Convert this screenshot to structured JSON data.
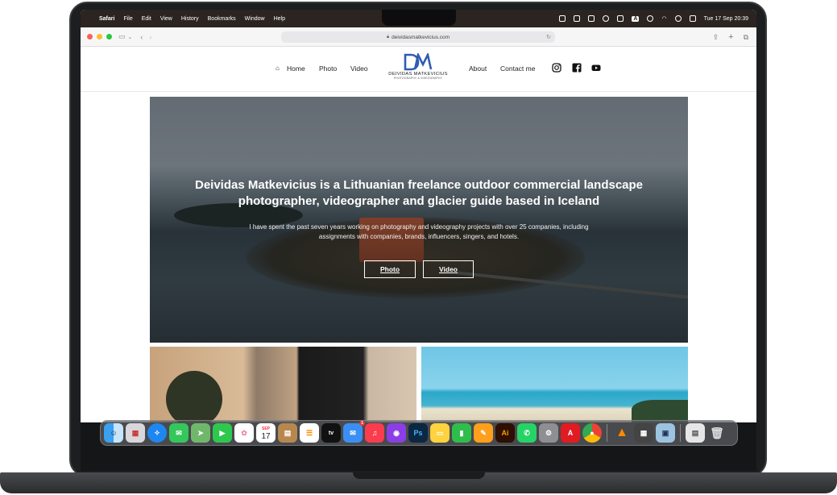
{
  "menubar": {
    "apple": "",
    "app_name": "Safari",
    "menus": [
      "File",
      "Edit",
      "View",
      "History",
      "Bookmarks",
      "Window",
      "Help"
    ],
    "datetime": "Tue 17 Sep  20:39",
    "input_source": "A"
  },
  "browser": {
    "url": "deividasmatkevicius.com",
    "lock_icon": "lock-icon"
  },
  "site": {
    "nav": {
      "home": "Home",
      "photo": "Photo",
      "video": "Video",
      "about": "About",
      "contact": "Contact me"
    },
    "logo": {
      "mark": "DM",
      "name": "DEIVIDAS MATKEVICIUS",
      "tagline": "PHOTOGRAPHY & VIDEOGRAPHY"
    },
    "hero": {
      "title": "Deividas Matkevicius is a Lithuanian freelance outdoor commercial landscape photographer, videographer and glacier guide based in Iceland",
      "subtitle": "I have spent the past seven years working on photography and videography projects with over 25 companies, including assignments with companies, brands, influencers, singers, and hotels.",
      "button_photo": "Photo",
      "button_video": "Video"
    }
  },
  "dock": {
    "calendar_month": "SEP",
    "calendar_day": "17",
    "mail_badge": "1",
    "apps": [
      "Finder",
      "Launchpad",
      "Safari",
      "Messages",
      "Maps",
      "FaceTime",
      "Photos",
      "Calendar",
      "Notes",
      "Reminders",
      "TV",
      "Mail",
      "Music",
      "Podcasts",
      "Photoshop",
      "Notes",
      "Numbers",
      "Pages",
      "Illustrator",
      "WhatsApp",
      "System Settings",
      "Acrobat",
      "Chrome",
      "VLC",
      "Calculator",
      "Preview",
      "Downloads",
      "Trash"
    ]
  },
  "colors": {
    "accent": "#2f5db1",
    "menubar": "#2b2420",
    "light_red": "#ff5f57",
    "light_yellow": "#febc2e",
    "light_green": "#28c840"
  }
}
